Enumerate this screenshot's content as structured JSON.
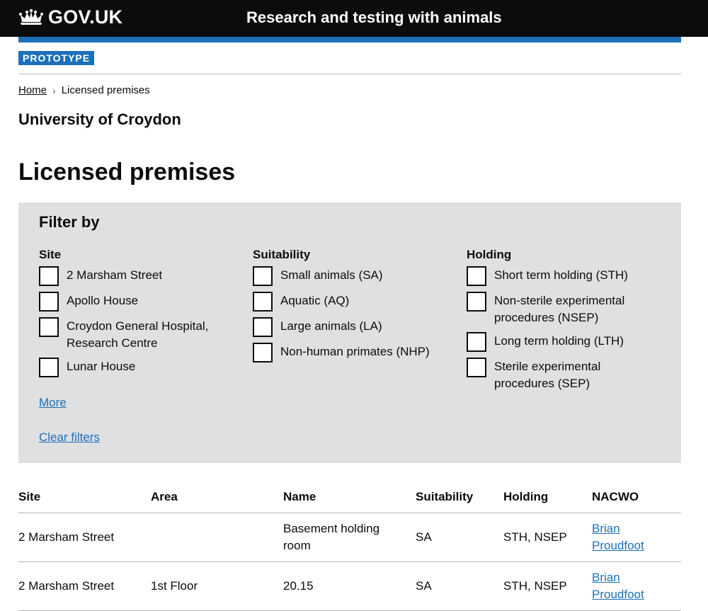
{
  "header": {
    "logo_text": "GOV.UK",
    "service_name": "Research and testing with animals"
  },
  "phase_tag": "PROTOTYPE",
  "breadcrumb": {
    "home": "Home",
    "current": "Licensed premises"
  },
  "establishment_name": "University of Croydon",
  "page_title": "Licensed premises",
  "filters": {
    "heading": "Filter by",
    "site": {
      "heading": "Site",
      "options": [
        "2 Marsham Street",
        "Apollo House",
        "Croydon General Hospital, Research Centre",
        "Lunar House"
      ]
    },
    "suitability": {
      "heading": "Suitability",
      "options": [
        "Small animals (SA)",
        "Aquatic (AQ)",
        "Large animals (LA)",
        "Non-human primates (NHP)"
      ]
    },
    "holding": {
      "heading": "Holding",
      "options": [
        "Short term holding (STH)",
        "Non-sterile experimental procedures (NSEP)",
        "Long term holding (LTH)",
        "Sterile experimental procedures (SEP)"
      ]
    },
    "more_link": "More",
    "clear_link": "Clear filters"
  },
  "table": {
    "headers": [
      "Site",
      "Area",
      "Name",
      "Suitability",
      "Holding",
      "NACWO"
    ],
    "rows": [
      [
        "2 Marsham Street",
        "",
        "Basement holding room",
        "SA",
        "STH, NSEP",
        "Brian Proudfoot"
      ],
      [
        "2 Marsham Street",
        "1st Floor",
        "20.15",
        "SA",
        "STH, NSEP",
        "Brian Proudfoot"
      ]
    ]
  },
  "colors": {
    "header_bg": "#0b0c0c",
    "brand_blue": "#1d70b8",
    "filter_bg": "#dee0e2",
    "link": "#1d70b8"
  }
}
